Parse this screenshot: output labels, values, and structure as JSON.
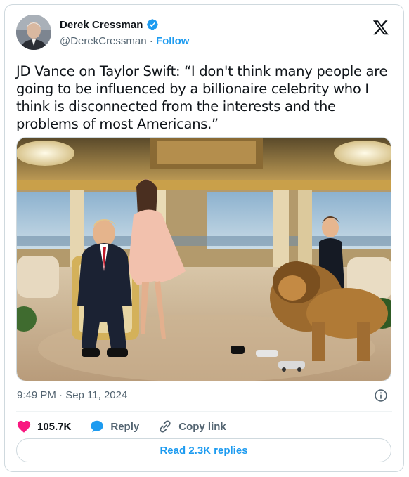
{
  "author": {
    "name": "Derek Cressman",
    "handle": "@DerekCressman",
    "separator": "·",
    "follow_label": "Follow",
    "verified": true
  },
  "tweet": {
    "text": "JD Vance on Taylor Swift: “I don't think many people are going to be influenced by a billionaire celebrity who I think is disconnected from the interests and the problems of most Americans.”",
    "timestamp": "9:49 PM · Sep 11, 2024"
  },
  "actions": {
    "likes_count": "105.7K",
    "reply_label": "Reply",
    "copy_link_label": "Copy link"
  },
  "replies": {
    "label": "Read 2.3K replies"
  },
  "colors": {
    "accent": "#1d9bf0",
    "like": "#f91880",
    "muted": "#536471",
    "border": "#cfd9de"
  },
  "icons": [
    "verified-badge-icon",
    "x-logo-icon",
    "info-icon",
    "heart-icon",
    "reply-bubble-icon",
    "link-icon"
  ]
}
